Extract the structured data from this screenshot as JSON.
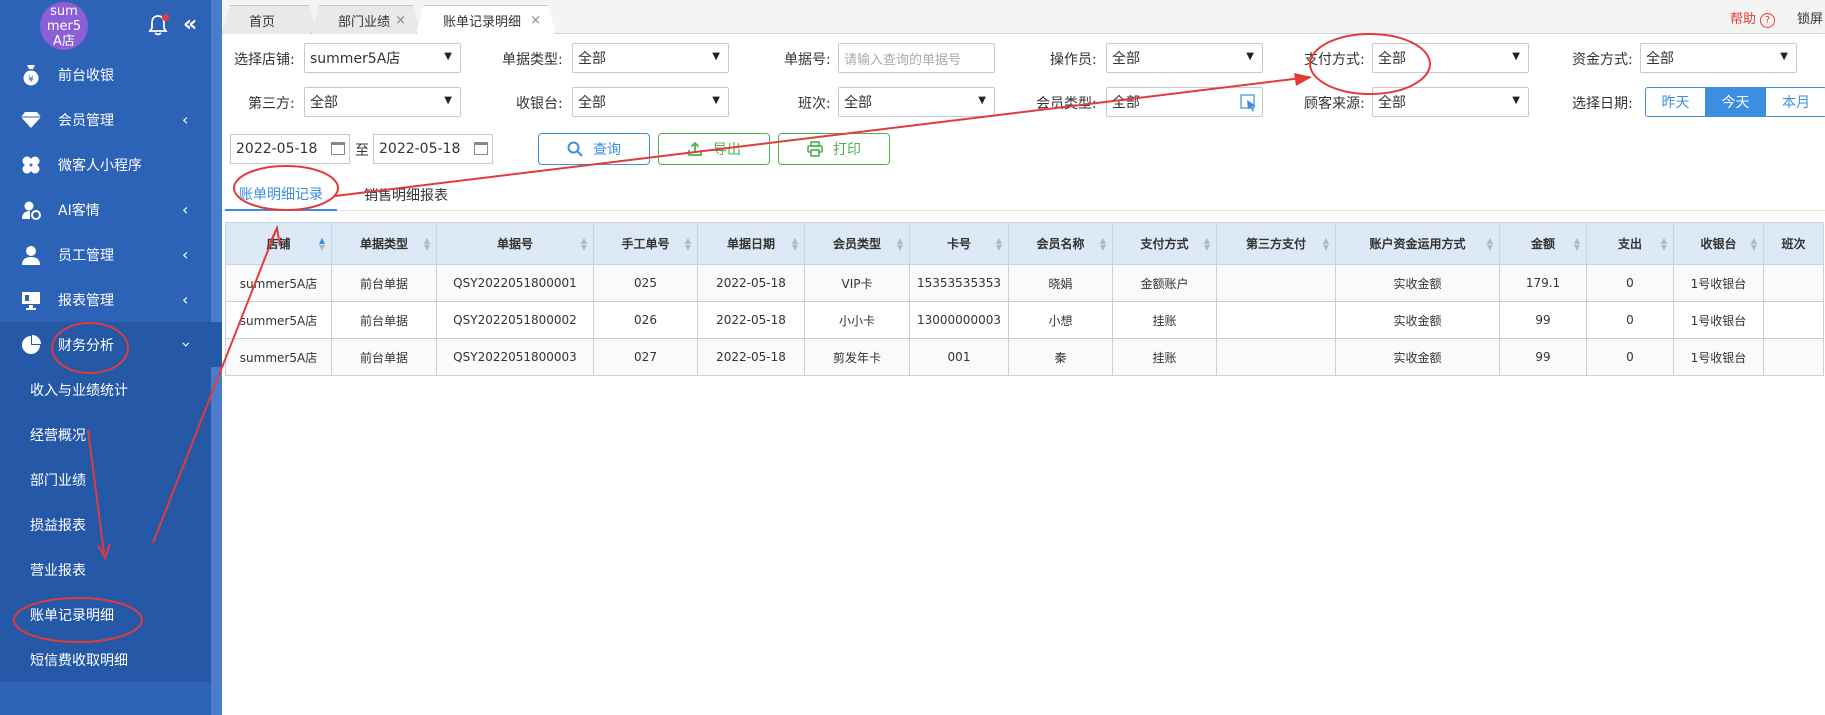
{
  "sidebar": {
    "store_name": "summer5A店",
    "items": [
      {
        "label": "前台收银",
        "icon": "money-bag-icon"
      },
      {
        "label": "会员管理",
        "icon": "diamond-icon"
      },
      {
        "label": "微客人小程序",
        "icon": "clover-icon"
      },
      {
        "label": "AI客情",
        "icon": "user-settings-icon"
      },
      {
        "label": "员工管理",
        "icon": "user-icon"
      },
      {
        "label": "报表管理",
        "icon": "monitor-icon"
      },
      {
        "label": "财务分析",
        "icon": "pie-chart-icon"
      }
    ],
    "sub_items": [
      "收入与业绩统计",
      "经营概况",
      "部门业绩",
      "损益报表",
      "营业报表",
      "账单记录明细",
      "短信费收取明细"
    ]
  },
  "topbar": {
    "tabs": [
      "首页",
      "部门业绩",
      "账单记录明细"
    ],
    "help": "帮助",
    "lock": "锁屏"
  },
  "filters": {
    "store_label": "选择店铺:",
    "store_value": "summer5A店",
    "doc_type_label": "单据类型:",
    "doc_type_value": "全部",
    "doc_no_label": "单据号:",
    "doc_no_placeholder": "请输入查询的单据号",
    "operator_label": "操作员:",
    "operator_value": "全部",
    "pay_method_label": "支付方式:",
    "pay_method_value": "全部",
    "fund_method_label": "资金方式:",
    "fund_method_value": "全部",
    "third_label": "第三方:",
    "third_value": "全部",
    "cashier_label": "收银台:",
    "cashier_value": "全部",
    "shift_label": "班次:",
    "shift_value": "全部",
    "member_type_label": "会员类型:",
    "member_type_value": "全部",
    "source_label": "顾客来源:",
    "source_value": "全部",
    "date_label": "选择日期:",
    "date_options": [
      "昨天",
      "今天",
      "本月"
    ],
    "date_from": "2022-05-18",
    "date_to_sep": "至",
    "date_to": "2022-05-18"
  },
  "buttons": {
    "query": "查询",
    "export": "导出",
    "print": "打印"
  },
  "subtabs": [
    "账单明细记录",
    "销售明细报表"
  ],
  "table": {
    "headers": [
      "店铺",
      "单据类型",
      "单据号",
      "手工单号",
      "单据日期",
      "会员类型",
      "卡号",
      "会员名称",
      "支付方式",
      "第三方支付",
      "账户资金运用方式",
      "金额",
      "支出",
      "收银台",
      "班次"
    ],
    "rows": [
      [
        "summer5A店",
        "前台单据",
        "QSY2022051800001",
        "025",
        "2022-05-18",
        "VIP卡",
        "15353535353",
        "晓娟",
        "金额账户",
        "",
        "实收金额",
        "179.1",
        "0",
        "1号收银台",
        ""
      ],
      [
        "summer5A店",
        "前台单据",
        "QSY2022051800002",
        "026",
        "2022-05-18",
        "小小卡",
        "13000000003",
        "小想",
        "挂账",
        "",
        "实收金额",
        "99",
        "0",
        "1号收银台",
        ""
      ],
      [
        "summer5A店",
        "前台单据",
        "QSY2022051800003",
        "027",
        "2022-05-18",
        "剪发年卡",
        "001",
        "秦",
        "挂账",
        "",
        "实收金额",
        "99",
        "0",
        "1号收银台",
        ""
      ]
    ]
  },
  "colors": {
    "sidebar": "#2d63b7",
    "accent": "#3c8ee0",
    "annotation": "#e23b3b",
    "green": "#4cb050"
  }
}
